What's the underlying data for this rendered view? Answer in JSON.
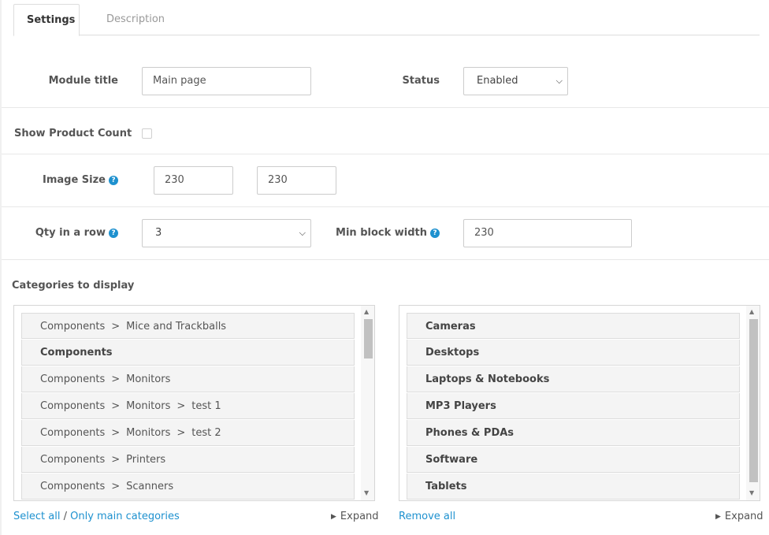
{
  "tabs": [
    {
      "label": "Settings",
      "active": true
    },
    {
      "label": "Description",
      "active": false
    }
  ],
  "module_title": {
    "label": "Module title",
    "value": "Main page"
  },
  "status": {
    "label": "Status",
    "selected": "Enabled"
  },
  "show_product_count": {
    "label": "Show Product Count",
    "checked": false
  },
  "image_size": {
    "label": "Image Size",
    "width": "230",
    "height": "230"
  },
  "qty_in_row": {
    "label": "Qty in a row",
    "selected": "3"
  },
  "min_block_width": {
    "label": "Min block width",
    "value": "230"
  },
  "help_icon": "?",
  "categories": {
    "label": "Categories to display",
    "left_list": [
      [
        "Components",
        "Mice and Trackballs"
      ],
      [
        "Components"
      ],
      [
        "Components",
        "Monitors"
      ],
      [
        "Components",
        "Monitors",
        "test 1"
      ],
      [
        "Components",
        "Monitors",
        "test 2"
      ],
      [
        "Components",
        "Printers"
      ],
      [
        "Components",
        "Scanners"
      ]
    ],
    "right_list": [
      "Cameras",
      "Desktops",
      "Laptops & Notebooks",
      "MP3 Players",
      "Phones & PDAs",
      "Software",
      "Tablets"
    ],
    "separator": ">",
    "left_links": {
      "select_all": "Select all",
      "slash": "/",
      "only_main": "Only main categories",
      "expand": "Expand"
    },
    "right_links": {
      "remove_all": "Remove all",
      "expand": "Expand"
    }
  },
  "colors": {
    "accent": "#1e91cf",
    "label": "#555555",
    "border": "#cccccc"
  }
}
